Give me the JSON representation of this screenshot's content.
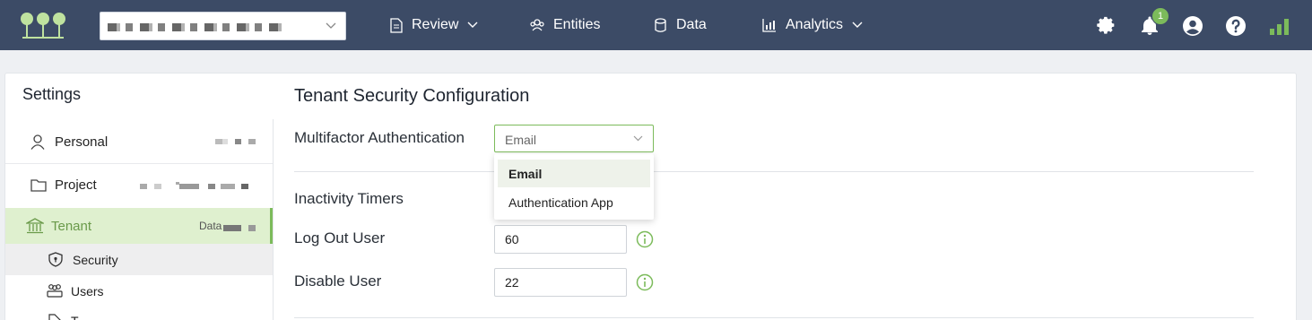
{
  "nav": {
    "review": "Review",
    "entities": "Entities",
    "data": "Data",
    "analytics": "Analytics",
    "notification_count": "1"
  },
  "sidebar": {
    "title": "Settings",
    "items": [
      {
        "label": "Personal",
        "icon": "user-icon"
      },
      {
        "label": "Project",
        "icon": "folder-icon"
      },
      {
        "label": "Tenant",
        "icon": "bank-icon",
        "suffix": "Data"
      },
      {
        "label": "Security",
        "icon": "shield-icon"
      },
      {
        "label": "Users",
        "icon": "users-icon"
      },
      {
        "label": "T",
        "icon": "tag-icon"
      }
    ]
  },
  "main": {
    "title": "Tenant Security Configuration",
    "mfa_label": "Multifactor Authentication",
    "mfa_value": "Email",
    "mfa_options": [
      "Email",
      "Authentication App"
    ],
    "inactivity_title": "Inactivity Timers",
    "logout_label": "Log Out User",
    "logout_value": "60",
    "disable_label": "Disable User",
    "disable_value": "22"
  },
  "colors": {
    "topbar": "#3c4b66",
    "accent": "#7cbb5b",
    "selected_row": "#dff0cf"
  }
}
